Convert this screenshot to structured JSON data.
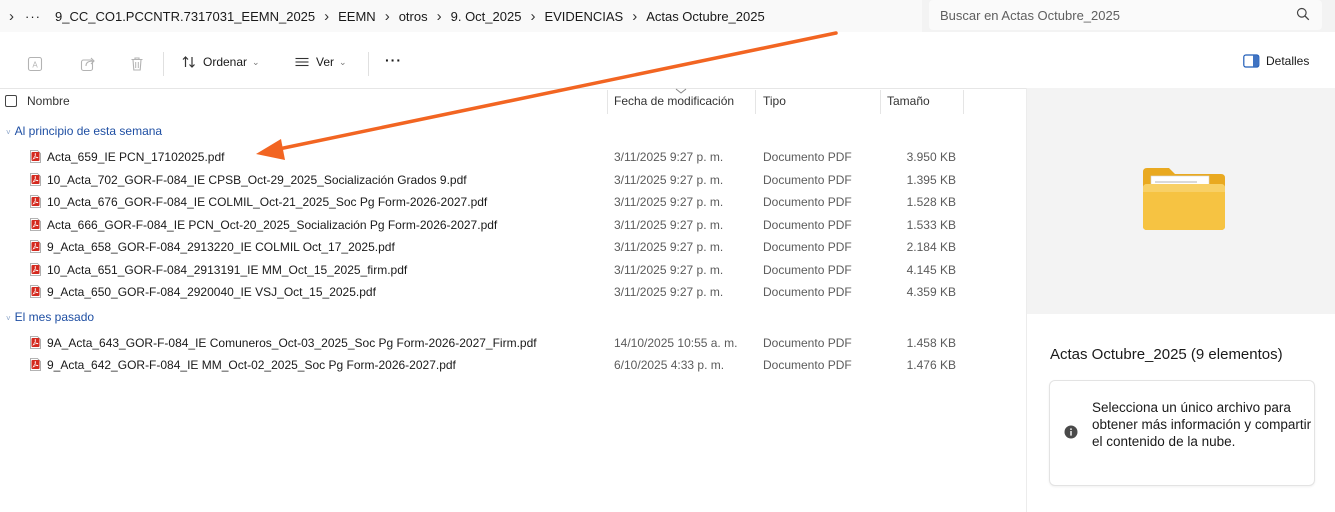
{
  "address_bar": {
    "more": "···",
    "path": [
      "9_CC_CO1.PCCNTR.7317031_EEMN_2025",
      "EEMN",
      "otros",
      "9. Oct_2025",
      "EVIDENCIAS",
      "Actas Octubre_2025"
    ]
  },
  "search": {
    "placeholder": "Buscar en Actas Octubre_2025",
    "icon": "search-icon"
  },
  "toolbar": {
    "sort_label": "Ordenar",
    "view_label": "Ver",
    "more_label": "···",
    "details_label": "Detalles"
  },
  "columns": {
    "name": "Nombre",
    "date": "Fecha de modificación",
    "type": "Tipo",
    "size": "Tamaño"
  },
  "groups": [
    {
      "label": "Al principio de esta semana",
      "files": [
        {
          "name": "Acta_659_IE PCN_17102025.pdf",
          "date": "3/11/2025 9:27 p. m.",
          "type": "Documento PDF",
          "size": "3.950 KB"
        },
        {
          "name": "10_Acta_702_GOR-F-084_IE CPSB_Oct-29_2025_Socialización Grados 9.pdf",
          "date": "3/11/2025 9:27 p. m.",
          "type": "Documento PDF",
          "size": "1.395 KB"
        },
        {
          "name": "10_Acta_676_GOR-F-084_IE COLMIL_Oct-21_2025_Soc Pg Form-2026-2027.pdf",
          "date": "3/11/2025 9:27 p. m.",
          "type": "Documento PDF",
          "size": "1.528 KB"
        },
        {
          "name": "Acta_666_GOR-F-084_IE PCN_Oct-20_2025_Socialización Pg Form-2026-2027.pdf",
          "date": "3/11/2025 9:27 p. m.",
          "type": "Documento PDF",
          "size": "1.533 KB"
        },
        {
          "name": "9_Acta_658_GOR-F-084_2913220_IE COLMIL Oct_17_2025.pdf",
          "date": "3/11/2025 9:27 p. m.",
          "type": "Documento PDF",
          "size": "2.184 KB"
        },
        {
          "name": "10_Acta_651_GOR-F-084_2913191_IE MM_Oct_15_2025_firm.pdf",
          "date": "3/11/2025 9:27 p. m.",
          "type": "Documento PDF",
          "size": "4.145 KB"
        },
        {
          "name": "9_Acta_650_GOR-F-084_2920040_IE VSJ_Oct_15_2025.pdf",
          "date": "3/11/2025 9:27 p. m.",
          "type": "Documento PDF",
          "size": "4.359 KB"
        }
      ]
    },
    {
      "label": "El mes pasado",
      "files": [
        {
          "name": "9A_Acta_643_GOR-F-084_IE Comuneros_Oct-03_2025_Soc Pg Form-2026-2027_Firm.pdf",
          "date": "14/10/2025 10:55 a. m.",
          "type": "Documento PDF",
          "size": "1.458 KB"
        },
        {
          "name": "9_Acta_642_GOR-F-084_IE MM_Oct-02_2025_Soc Pg Form-2026-2027.pdf",
          "date": "6/10/2025 4:33 p. m.",
          "type": "Documento PDF",
          "size": "1.476 KB"
        }
      ]
    }
  ],
  "details": {
    "title": "Actas Octubre_2025 (9 elementos)",
    "info": "Selecciona un único archivo para obtener más información y compartir el contenido de la nube."
  },
  "colors": {
    "accent": "#1f4fa3",
    "arrow": "#f26522",
    "pdf_red": "#d42a1f",
    "folder": "#f6c342"
  }
}
